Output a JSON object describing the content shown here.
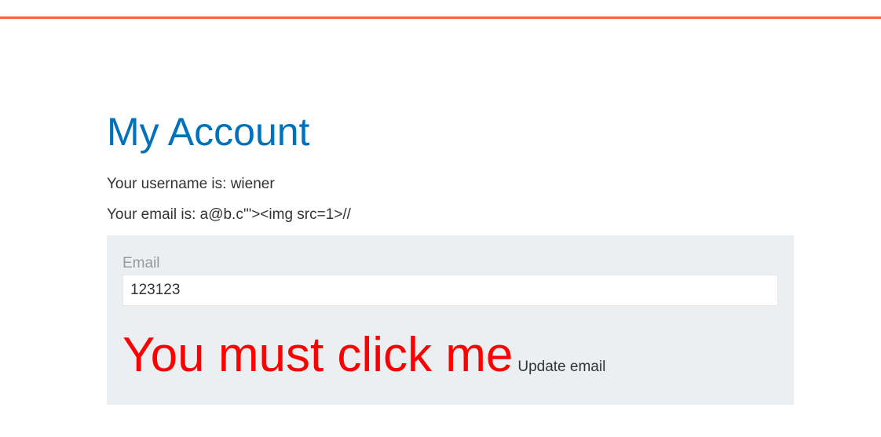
{
  "page": {
    "title": "My Account"
  },
  "account": {
    "username_line": "Your username is: wiener",
    "email_line": "Your email is: a@b.c'\"><img src=1>//"
  },
  "form": {
    "email_label": "Email",
    "email_value": "123123",
    "overlay_text": "You must click me",
    "update_button_label": "Update email"
  },
  "colors": {
    "accent_bar": "#ff6633",
    "title": "#0071bc",
    "panel_bg": "#ebeff2",
    "overlay_text": "#ff0000"
  }
}
